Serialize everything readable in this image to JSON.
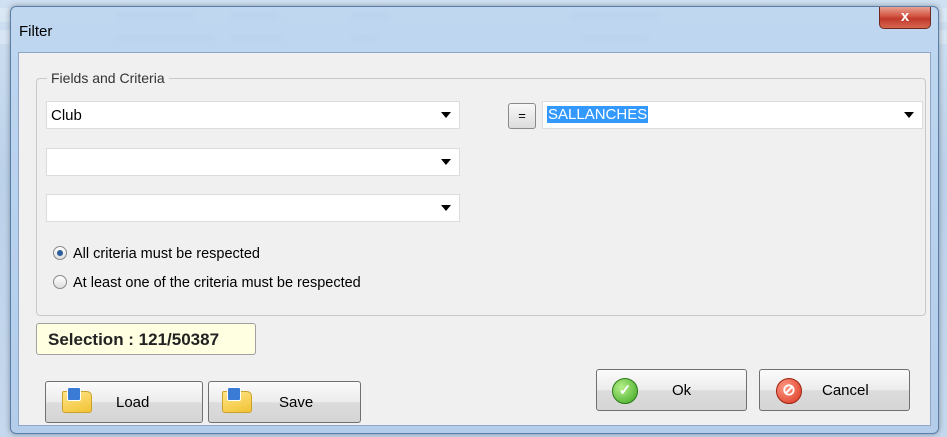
{
  "window": {
    "title": "Filter",
    "close_glyph": "x"
  },
  "group": {
    "legend": "Fields and Criteria"
  },
  "fields": {
    "field1": {
      "value": "Club"
    },
    "field2": {
      "value": ""
    },
    "field3": {
      "value": ""
    },
    "operator": {
      "label": "="
    },
    "criteria_value": "SALLANCHES"
  },
  "radios": [
    {
      "label": "All criteria must be respected",
      "checked": true
    },
    {
      "label": "At least one of the criteria must be respected",
      "checked": false
    }
  ],
  "selection": {
    "text": "Selection : 121/50387"
  },
  "buttons": {
    "load": {
      "label": "Load",
      "icon": "folder-open-icon"
    },
    "save": {
      "label": "Save",
      "icon": "folder-save-icon"
    },
    "ok": {
      "label": "Ok",
      "icon": "checkmark-icon"
    },
    "cancel": {
      "label": "Cancel",
      "icon": "cancel-icon"
    }
  },
  "colors": {
    "selection_highlight": "#3399ff",
    "selection_box_bg": "#ffffe1",
    "close_button": "#c0392b"
  }
}
